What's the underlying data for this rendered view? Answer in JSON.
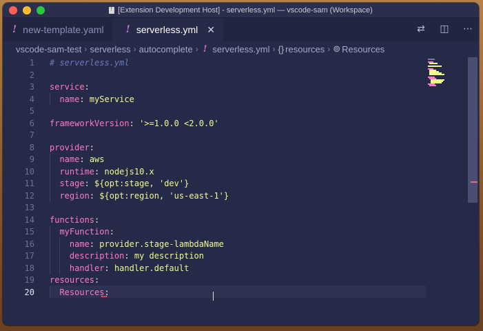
{
  "window": {
    "title": "[Extension Development Host] - serverless.yml — vscode-sam (Workspace)"
  },
  "tabs": [
    {
      "label": "new-template.yaml",
      "icon": "yaml-exclamation-icon",
      "active": false
    },
    {
      "label": "serverless.yml",
      "icon": "yaml-exclamation-icon",
      "active": true,
      "close": "✕"
    }
  ],
  "breadcrumb": {
    "items": [
      "vscode-sam-test",
      "serverless",
      "autocomplete",
      "serverless.yml",
      "resources",
      "Resources"
    ],
    "symbols": {
      "resources": "{}",
      "Resources": "⊚"
    }
  },
  "editor": {
    "current_line": 20,
    "lines": [
      {
        "n": "1",
        "text": "# serverless.yml"
      },
      {
        "n": "2",
        "text": ""
      },
      {
        "n": "3",
        "text": "service:"
      },
      {
        "n": "4",
        "text": "  name: myService"
      },
      {
        "n": "5",
        "text": ""
      },
      {
        "n": "6",
        "text": "frameworkVersion: '>=1.0.0 <2.0.0'"
      },
      {
        "n": "7",
        "text": ""
      },
      {
        "n": "8",
        "text": "provider:"
      },
      {
        "n": "9",
        "text": "  name: aws"
      },
      {
        "n": "10",
        "text": "  runtime: nodejs10.x"
      },
      {
        "n": "11",
        "text": "  stage: ${opt:stage, 'dev'}"
      },
      {
        "n": "12",
        "text": "  region: ${opt:region, 'us-east-1'}"
      },
      {
        "n": "13",
        "text": ""
      },
      {
        "n": "14",
        "text": "functions:"
      },
      {
        "n": "15",
        "text": "  myFunction:"
      },
      {
        "n": "16",
        "text": "    name: provider.stage-lambdaName"
      },
      {
        "n": "17",
        "text": "    description: my description"
      },
      {
        "n": "18",
        "text": "    handler: handler.default"
      },
      {
        "n": "19",
        "text": "resources:"
      },
      {
        "n": "20",
        "text": "  Resources:"
      }
    ]
  },
  "colors": {
    "background": "#262a49",
    "key": "#ff79c6",
    "value": "#f1fa8c",
    "comment": "#6b7bb8",
    "line_number": "#6d7199",
    "error_squiggle": "#ff5555"
  },
  "toolbar_icons": [
    "compare-changes-icon",
    "split-editor-icon",
    "more-actions-icon"
  ]
}
